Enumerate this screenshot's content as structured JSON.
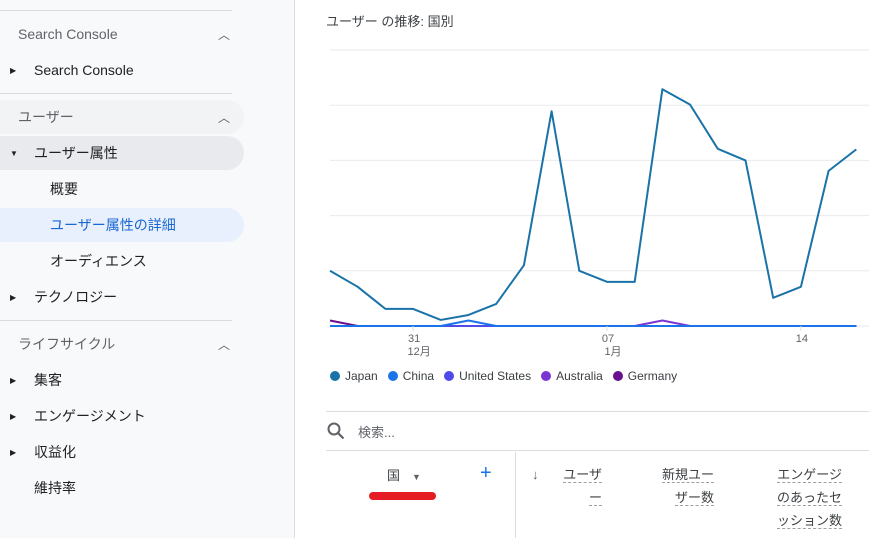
{
  "sidebar": {
    "sections": [
      {
        "label": "Search Console",
        "items": [
          {
            "label": "Search Console",
            "expanded": false
          }
        ]
      },
      {
        "label": "ユーザー",
        "items": [
          {
            "label": "ユーザー属性",
            "expanded": true,
            "children": [
              "概要",
              "ユーザー属性の詳細",
              "オーディエンス"
            ],
            "active_child": "ユーザー属性の詳細"
          },
          {
            "label": "テクノロジー",
            "expanded": false
          }
        ]
      },
      {
        "label": "ライフサイクル",
        "items": [
          {
            "label": "集客"
          },
          {
            "label": "エンゲージメント"
          },
          {
            "label": "収益化"
          },
          {
            "label": "維持率"
          }
        ]
      }
    ],
    "chevron_icon": "chevron-up-icon"
  },
  "main": {
    "chart_title": "ユーザー の推移: 国別",
    "search_placeholder": "検索...",
    "table": {
      "dimension_header": "国",
      "add_label": "+",
      "sort_icon": "↓",
      "columns": [
        [
          "ユーザ",
          "ー"
        ],
        [
          "新規ユー",
          "ザー数"
        ],
        [
          "エンゲージ",
          "のあったセ",
          "ッション数"
        ]
      ]
    }
  },
  "chart_data": {
    "type": "line",
    "title": "ユーザー の推移: 国別",
    "x": [
      "12-28",
      "12-29",
      "12-30",
      "12-31",
      "01-01",
      "01-02",
      "01-03",
      "01-04",
      "01-05",
      "01-06",
      "01-07",
      "01-08",
      "01-09",
      "01-10",
      "01-11",
      "01-12",
      "01-13",
      "01-14",
      "01-15",
      "01-16"
    ],
    "x_tick_labels": [
      {
        "index": 3,
        "day": "31",
        "month": "12月"
      },
      {
        "index": 10,
        "day": "07",
        "month": "1月"
      },
      {
        "index": 17,
        "day": "14",
        "month": ""
      }
    ],
    "ylim": [
      0,
      5
    ],
    "grid": true,
    "legend": "bottom-left",
    "series": [
      {
        "name": "Japan",
        "color": "#1a73a8",
        "values": [
          1.0,
          0.71,
          0.31,
          0.31,
          0.11,
          0.2,
          0.4,
          1.1,
          3.89,
          1.0,
          0.8,
          0.8,
          4.29,
          4.01,
          3.21,
          3.0,
          0.51,
          0.71,
          2.81,
          3.2
        ]
      },
      {
        "name": "China",
        "color": "#1a73e8",
        "values": [
          0,
          0,
          0,
          0,
          0,
          0.1,
          0,
          0,
          0,
          0,
          0,
          0,
          0,
          0,
          0,
          0,
          0,
          0,
          0,
          0
        ]
      },
      {
        "name": "United States",
        "color": "#4e4bea",
        "values": [
          0,
          0,
          0,
          0,
          0,
          0,
          0,
          0,
          0,
          0,
          0,
          0,
          0,
          0,
          0,
          0,
          0,
          0,
          0,
          0
        ]
      },
      {
        "name": "Australia",
        "color": "#7b35d4",
        "values": [
          0,
          0,
          0,
          0,
          0,
          0,
          0,
          0,
          0,
          0,
          0,
          0,
          0.1,
          0,
          0,
          0,
          0,
          0,
          0,
          0
        ]
      },
      {
        "name": "Germany",
        "color": "#6a0f8e",
        "values": [
          0.1,
          0,
          0,
          0,
          0,
          0,
          0,
          0,
          0,
          0,
          0,
          0,
          0,
          0,
          0,
          0,
          0,
          0,
          0,
          0
        ]
      }
    ]
  }
}
